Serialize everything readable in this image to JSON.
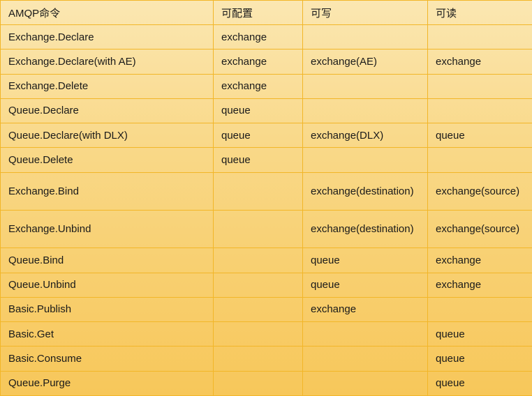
{
  "table": {
    "headers": [
      "AMQP命令",
      "可配置",
      "可写",
      "可读"
    ],
    "rows": [
      [
        "Exchange.Declare",
        "exchange",
        "",
        ""
      ],
      [
        "Exchange.Declare(with AE)",
        "exchange",
        "exchange(AE)",
        "exchange"
      ],
      [
        "Exchange.Delete",
        "exchange",
        "",
        ""
      ],
      [
        "Queue.Declare",
        "queue",
        "",
        ""
      ],
      [
        "Queue.Declare(with DLX)",
        "queue",
        "exchange(DLX)",
        "queue"
      ],
      [
        "Queue.Delete",
        "queue",
        "",
        ""
      ],
      [
        "Exchange.Bind",
        "",
        "exchange(destination)",
        "exchange(source)"
      ],
      [
        "Exchange.Unbind",
        "",
        "exchange(destination)",
        "exchange(source)"
      ],
      [
        "Queue.Bind",
        "",
        "queue",
        "exchange"
      ],
      [
        "Queue.Unbind",
        "",
        "queue",
        "exchange"
      ],
      [
        "Basic.Publish",
        "",
        "exchange",
        ""
      ],
      [
        "Basic.Get",
        "",
        "",
        "queue"
      ],
      [
        "Basic.Consume",
        "",
        "",
        "queue"
      ],
      [
        "Queue.Purge",
        "",
        "",
        "queue"
      ]
    ]
  }
}
